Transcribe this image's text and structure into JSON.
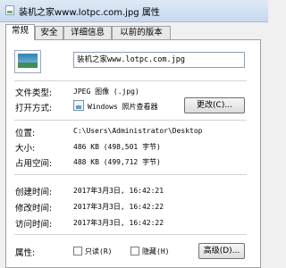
{
  "window": {
    "title": "装机之家www.lotpc.com.jpg 属性"
  },
  "tabs": [
    "常规",
    "安全",
    "详细信息",
    "以前的版本"
  ],
  "file": {
    "name": "装机之家www.lotpc.com.jpg"
  },
  "type": {
    "label": "文件类型:",
    "value": "JPEG 图像 (.jpg)"
  },
  "opens": {
    "label": "打开方式:",
    "value": "Windows 照片查看器",
    "button": "更改(C)..."
  },
  "location": {
    "label": "位置:",
    "value": "C:\\Users\\Administrator\\Desktop"
  },
  "size": {
    "label": "大小:",
    "value": "486 KB (498,501 字节)"
  },
  "disk_size": {
    "label": "占用空间:",
    "value": "488 KB (499,712 字节)"
  },
  "created": {
    "label": "创建时间:",
    "value": "2017年3月3日, 16:42:21"
  },
  "modified": {
    "label": "修改时间:",
    "value": "2017年3月3日, 16:42:22"
  },
  "accessed": {
    "label": "访问时间:",
    "value": "2017年3月3日, 16:42:22"
  },
  "attributes": {
    "label": "属性:",
    "readonly": "只读(R)",
    "hidden": "隐藏(H)",
    "advanced": "高级(D)..."
  }
}
